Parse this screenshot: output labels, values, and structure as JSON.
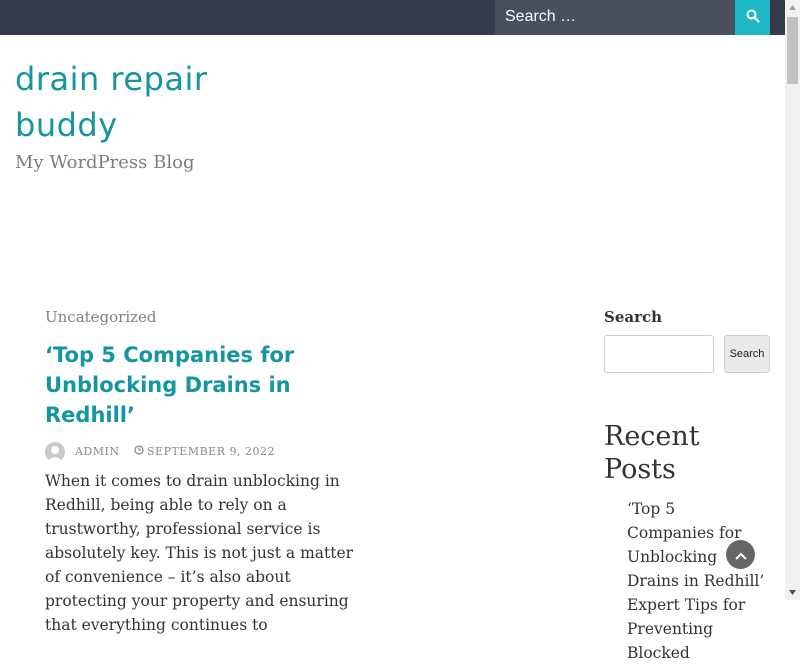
{
  "header": {
    "search_placeholder": "Search …",
    "accent_color": "#1eb8c7",
    "bar_color": "#363b49"
  },
  "site": {
    "title": "drain repair buddy",
    "description": "My WordPress Blog",
    "title_color": "#14959f"
  },
  "post": {
    "category": "Uncategorized",
    "title": "‘Top 5 Companies for Unblocking Drains in Redhill’",
    "author": "ADMIN",
    "date": "SEPTEMBER 9, 2022",
    "excerpt": "When it comes to drain unblocking in Redhill, being able to rely on a trustworthy, professional service is absolutely key. This is not just a matter of convenience – it’s also about protecting your property and ensuring that everything continues to"
  },
  "sidebar": {
    "search_title": "Search",
    "search_button": "Search",
    "recent_title": "Recent Posts",
    "recent_items": [
      "‘Top 5 Companies for Unblocking Drains in Redhill’",
      "Expert Tips for Preventing Blocked"
    ]
  },
  "icons": {
    "search": "search-icon",
    "clock": "clock-icon",
    "scroll_top": "chevron-up-icon"
  }
}
